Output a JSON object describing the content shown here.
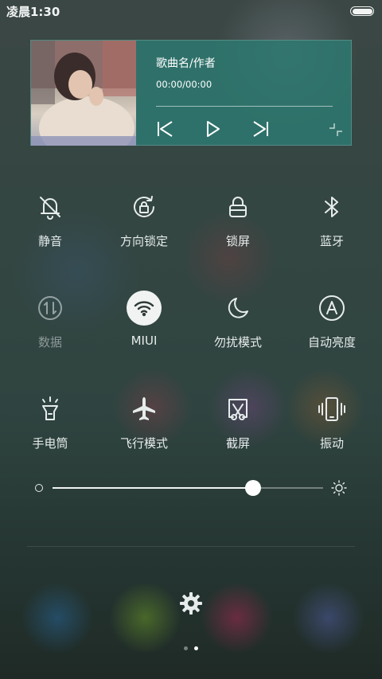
{
  "status_bar": {
    "time": "凌晨1:30"
  },
  "music": {
    "title": "歌曲名/作者",
    "time": "00:00/00:00"
  },
  "toggles": [
    {
      "label": "静音",
      "icon": "bell-off-icon",
      "state": "off"
    },
    {
      "label": "方向锁定",
      "icon": "rotation-lock-icon",
      "state": "off"
    },
    {
      "label": "锁屏",
      "icon": "lock-icon",
      "state": "off"
    },
    {
      "label": "蓝牙",
      "icon": "bluetooth-icon",
      "state": "off"
    },
    {
      "label": "数据",
      "icon": "mobile-data-icon",
      "state": "disabled"
    },
    {
      "label": "MIUI",
      "icon": "wifi-icon",
      "state": "on"
    },
    {
      "label": "勿扰模式",
      "icon": "moon-icon",
      "state": "off"
    },
    {
      "label": "自动亮度",
      "icon": "auto-brightness-icon",
      "state": "off"
    },
    {
      "label": "手电筒",
      "icon": "flashlight-icon",
      "state": "off"
    },
    {
      "label": "飞行模式",
      "icon": "airplane-icon",
      "state": "off"
    },
    {
      "label": "截屏",
      "icon": "screenshot-icon",
      "state": "off"
    },
    {
      "label": "振动",
      "icon": "vibrate-icon",
      "state": "off"
    }
  ],
  "brightness": {
    "level": 0.74
  },
  "pagination": {
    "count": 2,
    "current": 2
  },
  "colors": {
    "music_card": "#2e7870",
    "active_toggle_bg": "#f1f3f3",
    "text": "#e6ecec"
  }
}
